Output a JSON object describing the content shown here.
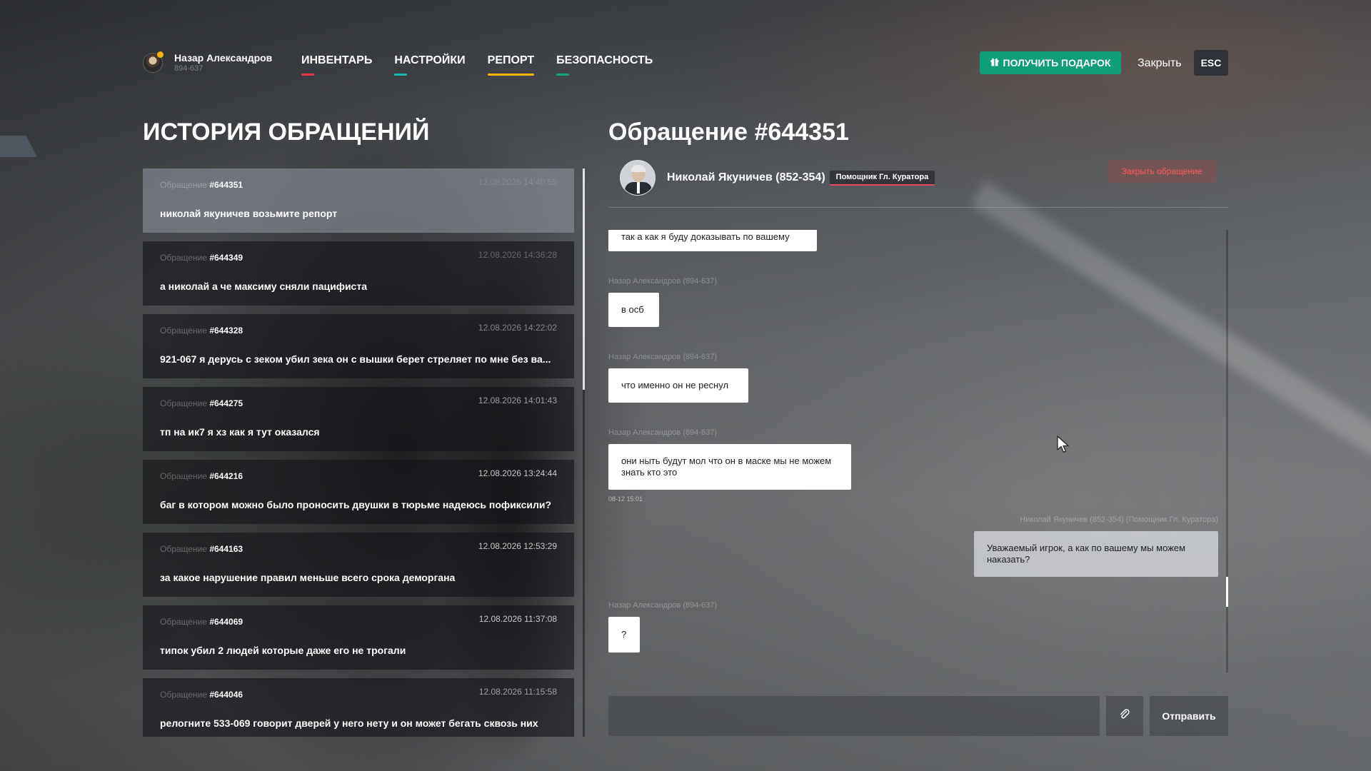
{
  "colors": {
    "gift": "#0f9d7a",
    "danger": "#ff5a5a",
    "role_badge_line": "#e24a5e"
  },
  "user": {
    "name": "Назар Александров",
    "id": "894-637"
  },
  "nav": [
    {
      "label": "ИНВЕНТАРЬ",
      "color": "#e03a4a"
    },
    {
      "label": "НАСТРОЙКИ",
      "color": "#17b7b0"
    },
    {
      "label": "РЕПОРТ",
      "color": "#f2b705"
    },
    {
      "label": "БЕЗОПАСНОСТЬ",
      "color": "#12a37f"
    }
  ],
  "header": {
    "gift_label": "ПОЛУЧИТЬ ПОДАРОК",
    "gift_icon": "gift-icon",
    "close_label": "Закрыть",
    "esc_label": "ESC"
  },
  "history": {
    "title": "ИСТОРИЯ ОБРАЩЕНИЙ",
    "label": "Обращение",
    "items": [
      {
        "num": "#644351",
        "date": "12.08.2026 14:40:55",
        "text": "николай якуничев возьмите репорт",
        "active": true
      },
      {
        "num": "#644349",
        "date": "12.08.2026 14:36:28",
        "text": "а николай а че максиму сняли пацифиста"
      },
      {
        "num": "#644328",
        "date": "12.08.2026 14:22:02",
        "text": "921-067 я дерусь с зеком убил зека он с вышки берет стреляет по мне без ва..."
      },
      {
        "num": "#644275",
        "date": "12.08.2026 14:01:43",
        "text": "тп на ик7 я хз как я тут оказался"
      },
      {
        "num": "#644216",
        "date": "12.08.2026 13:24:44",
        "text": "баг в котором можно было проносить двушки в тюрьме надеюсь пофиксили?"
      },
      {
        "num": "#644163",
        "date": "12.08.2026 12:53:29",
        "text": "за какое нарушение правил меньше всего срока деморгана"
      },
      {
        "num": "#644069",
        "date": "12.08.2026 11:37:08",
        "text": "типок убил 2 людей которые даже его не трогали"
      },
      {
        "num": "#644046",
        "date": "12.08.2026 11:15:58",
        "text": "релогните 533-069 говорит дверей у него нету и он может бегать сквозь них"
      }
    ]
  },
  "ticket": {
    "title": "Обращение #644351",
    "assignee": "Николай Якуничев (852-354)",
    "role": "Помощник Гл. Куратора",
    "close_label": "Закрыть обращение"
  },
  "chat": [
    {
      "author": "",
      "text": "так а как я буду доказывать по вашему",
      "side": "left"
    },
    {
      "author": "Назар Александров (894-637)",
      "text": "в осб",
      "side": "left"
    },
    {
      "author": "Назар Александров (894-637)",
      "text": "что именно он не реснул",
      "side": "left"
    },
    {
      "author": "Назар Александров (894-637)",
      "text": "они ныть будут мол что он в маске мы не можем знать кто это",
      "side": "left",
      "time": "08-12 15:01"
    },
    {
      "author": "Николай Якуничев (852-354) (Помощник Гл. Куратора)",
      "text": "Уважаемый игрок, а как по вашему мы можем наказать?",
      "side": "right"
    },
    {
      "author": "Назар Александров (894-637)",
      "text": "?",
      "side": "left"
    }
  ],
  "composer": {
    "placeholder": "",
    "send_label": "Отправить",
    "attach_icon": "paperclip-icon"
  }
}
